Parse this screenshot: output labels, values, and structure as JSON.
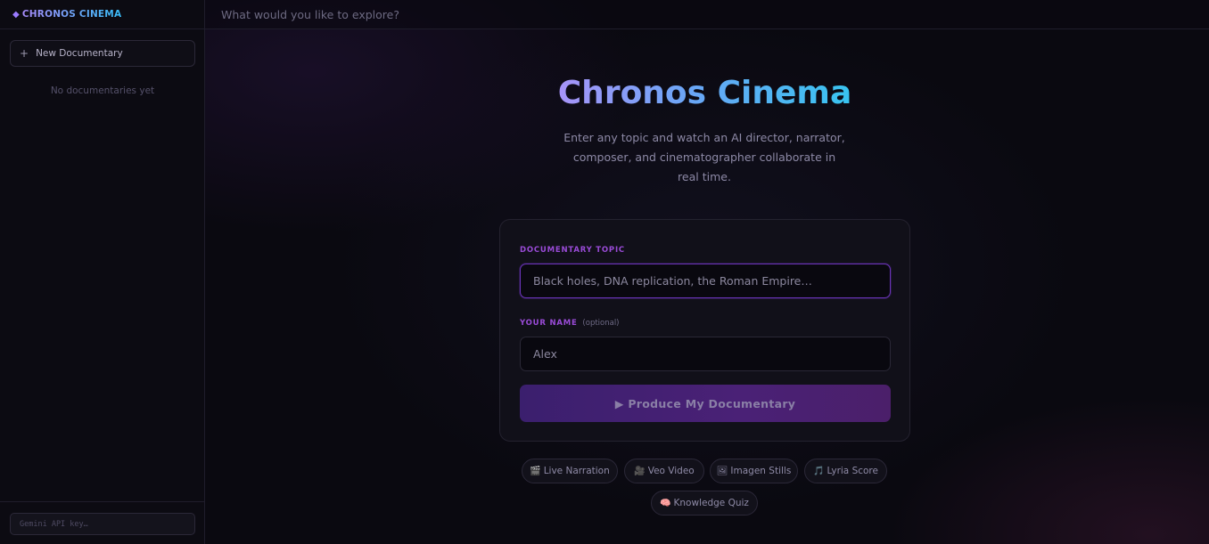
{
  "sidebar": {
    "brand_icon": "◆",
    "brand": "CHRONOS CINEMA",
    "new_doc_icon": "+",
    "new_doc_label": "New Documentary",
    "empty_state": "No documentaries yet",
    "api_key_placeholder": "Gemini API key…"
  },
  "topbar": {
    "placeholder": "What would you like to explore?"
  },
  "hero": {
    "title": "Chronos Cinema",
    "subtitle": "Enter any topic and watch an AI director, narrator, composer, and cinematographer collaborate in real time."
  },
  "form": {
    "topic_label": "DOCUMENTARY TOPIC",
    "topic_placeholder": "Black holes, DNA replication, the Roman Empire…",
    "name_label": "YOUR NAME",
    "name_optional": "(optional)",
    "name_placeholder": "Alex",
    "submit_label": "▶ Produce My Documentary"
  },
  "features": [
    {
      "icon": "🎬",
      "label": "Live Narration",
      "icon_name": "clapperboard-icon"
    },
    {
      "icon": "🎥",
      "label": "Veo Video",
      "icon_name": "video-camera-icon"
    },
    {
      "icon": "🖼",
      "label": "Imagen Stills",
      "icon_name": "picture-icon"
    },
    {
      "icon": "🎵",
      "label": "Lyria Score",
      "icon_name": "music-note-icon"
    },
    {
      "icon": "🧠",
      "label": "Knowledge Quiz",
      "icon_name": "brain-icon"
    }
  ],
  "colors": {
    "accent_purple": "#9a4bd8",
    "title_gradient_start": "#a794f8",
    "title_gradient_end": "#38c4f0",
    "background": "#09080f"
  }
}
